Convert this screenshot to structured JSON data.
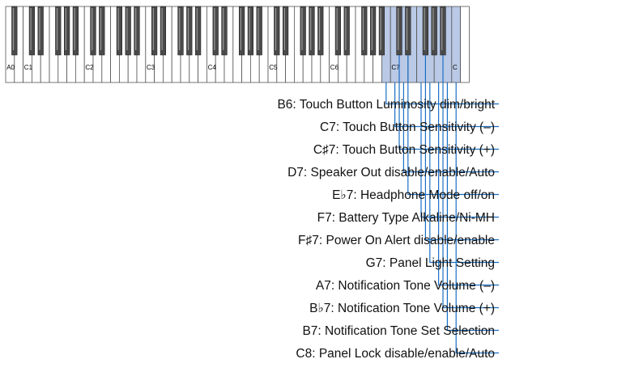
{
  "keyboard": {
    "octave_labels": [
      "A0",
      "C1",
      "C2",
      "C3",
      "C4",
      "C5",
      "C6",
      "C7",
      "C"
    ],
    "highlight_color": "#b9c9e6",
    "line_color": "#1a6fc4"
  },
  "functions": [
    {
      "key": "B6",
      "label": "B6: Touch Button Luminosity dim/bright"
    },
    {
      "key": "C7",
      "label": "C7: Touch Button Sensitivity (–)"
    },
    {
      "key": "C#7",
      "label": "C♯7: Touch Button Sensitivity (+)"
    },
    {
      "key": "D7",
      "label": "D7: Speaker Out disable/enable/Auto"
    },
    {
      "key": "Eb7",
      "label": "E♭7: Headphone Mode off/on"
    },
    {
      "key": "F7",
      "label": "F7: Battery Type Alkaline/Ni-MH"
    },
    {
      "key": "F#7",
      "label": "F♯7: Power On Alert disable/enable"
    },
    {
      "key": "G7",
      "label": "G7: Panel Light Setting"
    },
    {
      "key": "A7",
      "label": "A7: Notification Tone Volume (–)"
    },
    {
      "key": "Bb7",
      "label": "B♭7: Notification Tone Volume (+)"
    },
    {
      "key": "B7",
      "label": "B7: Notification Tone Set Selection"
    },
    {
      "key": "C8",
      "label": "C8: Panel Lock disable/enable/Auto"
    }
  ]
}
